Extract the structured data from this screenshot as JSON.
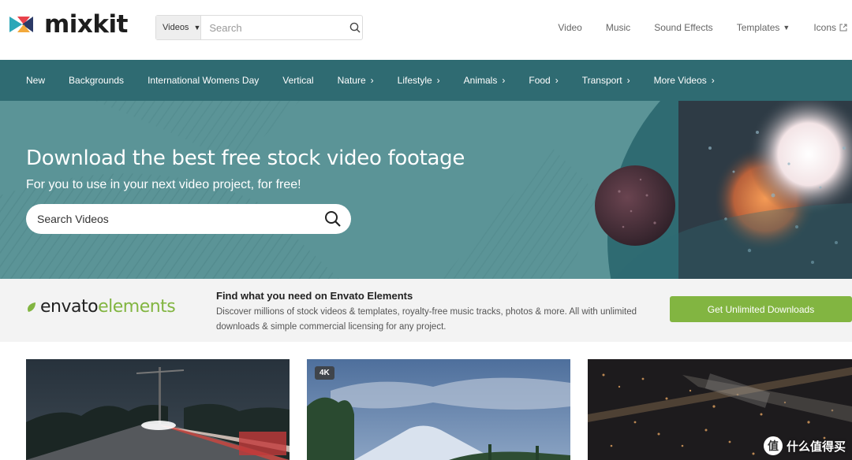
{
  "logo": {
    "text": "mixkit"
  },
  "search": {
    "category": "Videos",
    "placeholder": "Search"
  },
  "topnav": [
    {
      "label": "Video"
    },
    {
      "label": "Music"
    },
    {
      "label": "Sound Effects"
    },
    {
      "label": "Templates"
    },
    {
      "label": "Icons"
    }
  ],
  "categories": [
    {
      "label": "New"
    },
    {
      "label": "Backgrounds"
    },
    {
      "label": "International Womens Day"
    },
    {
      "label": "Vertical"
    },
    {
      "label": "Nature"
    },
    {
      "label": "Lifestyle"
    },
    {
      "label": "Animals"
    },
    {
      "label": "Food"
    },
    {
      "label": "Transport"
    },
    {
      "label": "More Videos"
    }
  ],
  "hero": {
    "title": "Download the best free stock video footage",
    "subtitle": "For you to use in your next video project, for free!",
    "search_placeholder": "Search Videos"
  },
  "envato": {
    "logo_part1": "envato",
    "logo_part2": "elements",
    "heading": "Find what you need on Envato Elements",
    "description": "Discover millions of stock videos & templates, royalty-free music tracks, photos & more. All with unlimited downloads & simple commercial licensing for any project.",
    "button": "Get Unlimited Downloads"
  },
  "thumbnails": [
    {
      "badge": ""
    },
    {
      "badge": "4K"
    },
    {
      "badge": ""
    }
  ],
  "watermark": {
    "icon": "值",
    "text": "什么值得买"
  },
  "colors": {
    "teal_dark": "#2f6b72",
    "teal_hero": "#5b9497",
    "envato_green": "#82b541"
  }
}
